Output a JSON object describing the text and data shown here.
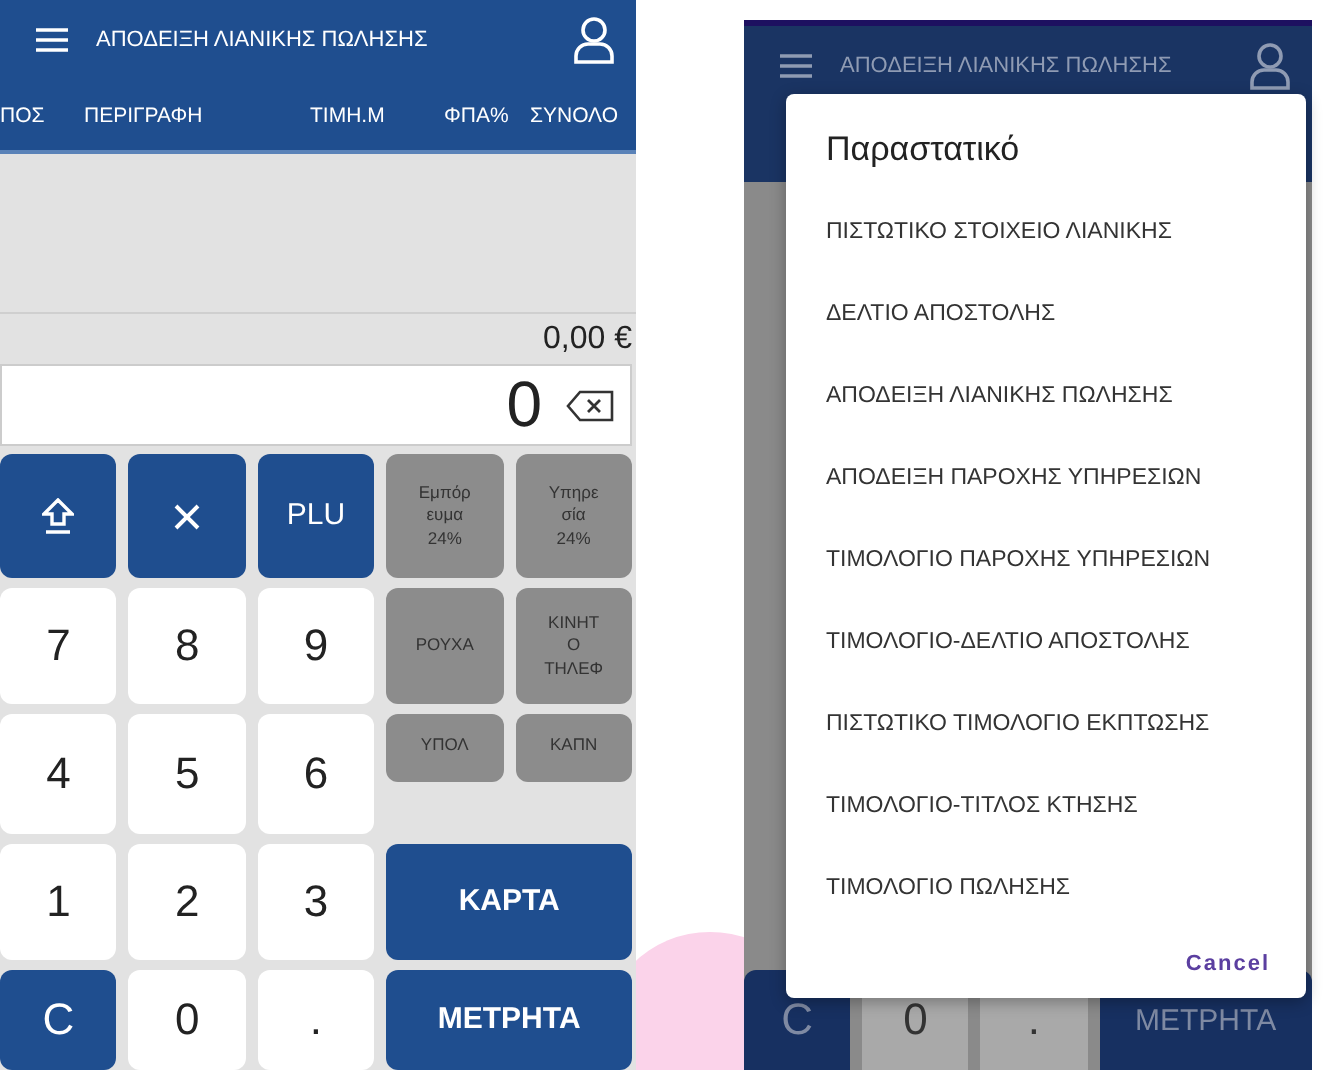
{
  "left_screen": {
    "header": {
      "title": "ΑΠΟΔΕΙΞΗ ΛΙΑΝΙΚΗΣ ΠΩΛΗΣΗΣ"
    },
    "columns": [
      "ΠΟΣ",
      "ΠΕΡΙΓΡΑΦΗ",
      "ΤΙΜΗ.Μ",
      "ΦΠΑ%",
      "ΣΥΝΟΛΟ"
    ],
    "total": "0,00 €",
    "amount": "0",
    "function_keys": [
      {
        "kind": "shift"
      },
      {
        "kind": "multiply"
      },
      {
        "kind": "text",
        "label": "PLU"
      }
    ],
    "keys": [
      {
        "label": "7",
        "kind": "digit"
      },
      {
        "label": "8",
        "kind": "digit"
      },
      {
        "label": "9",
        "kind": "digit"
      },
      {
        "label": "4",
        "kind": "digit"
      },
      {
        "label": "5",
        "kind": "digit"
      },
      {
        "label": "6",
        "kind": "digit"
      },
      {
        "label": "1",
        "kind": "digit"
      },
      {
        "label": "2",
        "kind": "digit"
      },
      {
        "label": "3",
        "kind": "digit"
      },
      {
        "label": "C",
        "kind": "action"
      },
      {
        "label": "0",
        "kind": "digit"
      },
      {
        "label": ".",
        "kind": "digit"
      }
    ],
    "category_tiles": [
      {
        "label": "Εμπόρ\nευμα\n24%"
      },
      {
        "label": "ΡΟΥΧΑ"
      },
      {
        "label": "ΥΠΟΛ"
      },
      {
        "label": "Υπηρε\nσία\n24%"
      },
      {
        "label": "ΚΙΝΗΤ\nΟ\nΤΗΛΕΦ"
      },
      {
        "label": "ΚΑΠΝ"
      }
    ],
    "payment_buttons": [
      "ΚΑΡΤΑ",
      "ΜΕΤΡΗΤΑ"
    ]
  },
  "right_screen": {
    "header": {
      "title": "ΑΠΟΔΕΙΞΗ ΛΙΑΝΙΚΗΣ ΠΩΛΗΣΗΣ"
    },
    "bottom_keys": [
      {
        "label": "C",
        "kind": "action"
      },
      {
        "label": "0",
        "kind": "digit"
      },
      {
        "label": ".",
        "kind": "digit"
      },
      {
        "label": "ΜΕΤΡΗΤΑ",
        "kind": "payment"
      }
    ],
    "dialog": {
      "title": "Παραστατικό",
      "options": [
        "ΠΙΣΤΩΤΙΚΟ ΣΤΟΙΧΕΙΟ ΛΙΑΝΙΚΗΣ",
        "ΔΕΛΤΙΟ ΑΠΟΣΤΟΛΗΣ",
        "ΑΠΟΔΕΙΞΗ ΛΙΑΝΙΚΗΣ ΠΩΛΗΣΗΣ",
        "ΑΠΟΔΕΙΞΗ ΠΑΡΟΧΗΣ ΥΠΗΡΕΣΙΩΝ",
        "ΤΙΜΟΛΟΓΙΟ ΠΑΡΟΧΗΣ ΥΠΗΡΕΣΙΩΝ",
        "ΤΙΜΟΛΟΓΙΟ-ΔΕΛΤΙΟ ΑΠΟΣΤΟΛΗΣ",
        "ΠΙΣΤΩΤΙΚΟ ΤΙΜΟΛΟΓΙΟ ΕΚΠΤΩΣΗΣ",
        "ΤΙΜΟΛΟΓΙΟ-ΤΙΤΛΟΣ ΚΤΗΣΗΣ",
        "ΤΙΜΟΛΟΓΙΟ ΠΩΛΗΣΗΣ"
      ],
      "cancel": "Cancel"
    }
  }
}
